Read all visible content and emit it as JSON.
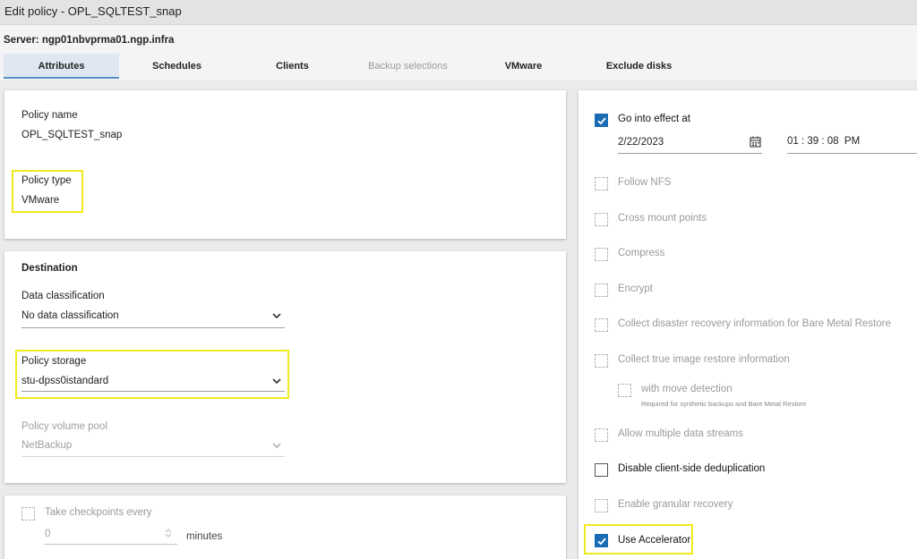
{
  "window": {
    "title": "Edit policy - OPL_SQLTEST_snap"
  },
  "header": {
    "server": "Server: ngp01nbvprma01.ngp.infra"
  },
  "tabs": [
    {
      "label": "Attributes",
      "state": "active"
    },
    {
      "label": "Schedules",
      "state": "normal"
    },
    {
      "label": "Clients",
      "state": "normal"
    },
    {
      "label": "Backup selections",
      "state": "disabled"
    },
    {
      "label": "VMware",
      "state": "normal"
    },
    {
      "label": "Exclude disks",
      "state": "normal"
    }
  ],
  "policy": {
    "name_label": "Policy name",
    "name_value": "OPL_SQLTEST_snap",
    "type_label": "Policy type",
    "type_value": "VMware"
  },
  "destination": {
    "title": "Destination",
    "classification_label": "Data classification",
    "classification_value": "No data classification",
    "storage_label": "Policy storage",
    "storage_value": "stu-dpss0istandard",
    "volume_pool_label": "Policy volume pool",
    "volume_pool_value": "NetBackup"
  },
  "checkpoints": {
    "label": "Take checkpoints every",
    "value": "0",
    "unit": "minutes"
  },
  "schedule": {
    "go_into_effect_label": "Go into effect at",
    "date": "2/22/2023",
    "time": "01 : 39 : 08  PM"
  },
  "options": [
    {
      "label": "Follow NFS",
      "checked": false,
      "enabled": false
    },
    {
      "label": "Cross mount points",
      "checked": false,
      "enabled": false
    },
    {
      "label": "Compress",
      "checked": false,
      "enabled": false
    },
    {
      "label": "Encrypt",
      "checked": false,
      "enabled": false
    },
    {
      "label": "Collect disaster recovery information for Bare Metal Restore",
      "checked": false,
      "enabled": false
    },
    {
      "label": "Collect true image restore information",
      "checked": false,
      "enabled": false
    },
    {
      "label": "Allow multiple data streams",
      "checked": false,
      "enabled": false
    },
    {
      "label": "Disable client-side deduplication",
      "checked": false,
      "enabled": true
    },
    {
      "label": "Enable granular recovery",
      "checked": false,
      "enabled": false
    },
    {
      "label": "Use Accelerator",
      "checked": true,
      "enabled": true
    }
  ],
  "move_detection": {
    "label": "with move detection",
    "hint": "Required for synthetic backups and Bare Metal Restore"
  },
  "colors": {
    "accent": "#1a6cb5",
    "highlight": "#f0ea1e",
    "tab_active_bg": "#dfe8f2"
  },
  "icons": {
    "calendar": "calendar-icon",
    "chevron": "chevron-down-icon",
    "check": "check-icon",
    "stepper": "stepper-icon"
  }
}
